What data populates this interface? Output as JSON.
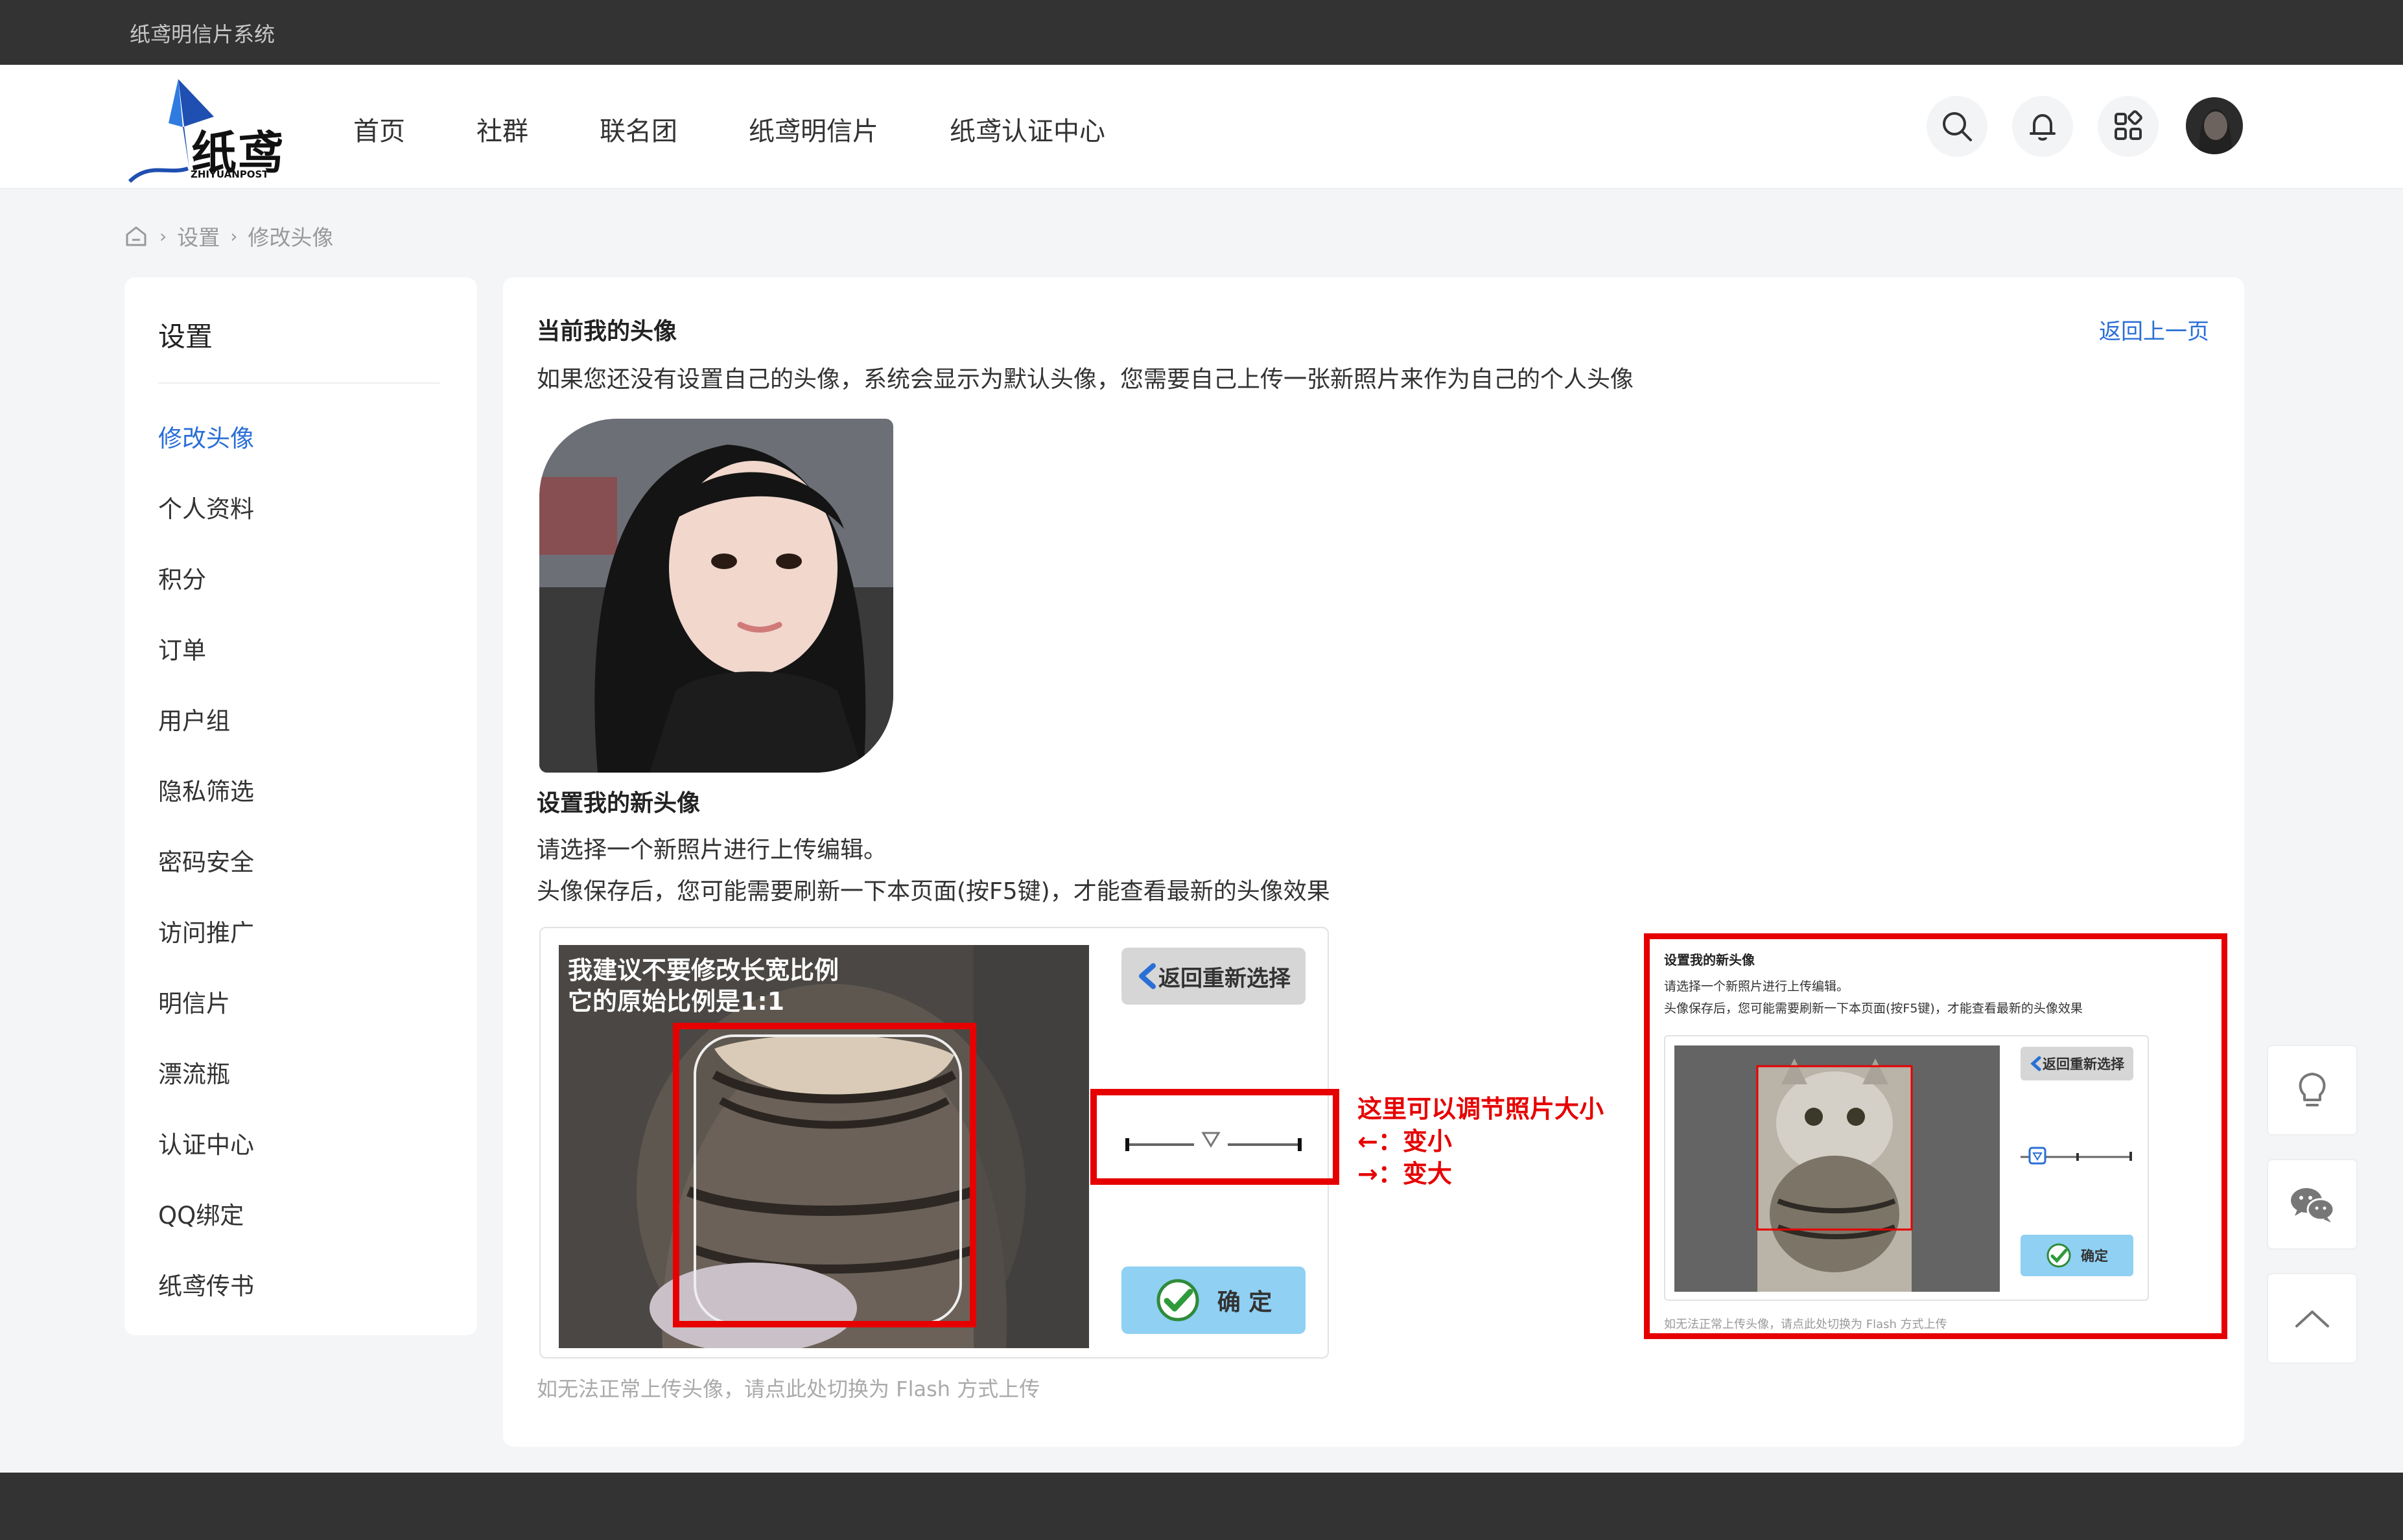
{
  "site": {
    "system_name": "纸鸢明信片系统"
  },
  "logo": {
    "text": "纸鸢",
    "sub": "ZHIYUANPOST"
  },
  "nav": [
    "首页",
    "社群",
    "联名团",
    "纸鸢明信片",
    "纸鸢认证中心"
  ],
  "header_icons": [
    "search-icon",
    "bell-icon",
    "apps-icon"
  ],
  "breadcrumb": {
    "home_icon": "home-icon",
    "items": [
      "设置",
      "修改头像"
    ],
    "separator": "›"
  },
  "sidebar": {
    "title": "设置",
    "items": [
      {
        "label": "修改头像",
        "active": true
      },
      {
        "label": "个人资料"
      },
      {
        "label": "积分"
      },
      {
        "label": "订单"
      },
      {
        "label": "用户组"
      },
      {
        "label": "隐私筛选"
      },
      {
        "label": "密码安全"
      },
      {
        "label": "访问推广"
      },
      {
        "label": "明信片"
      },
      {
        "label": "漂流瓶"
      },
      {
        "label": "认证中心"
      },
      {
        "label": "QQ绑定"
      },
      {
        "label": "纸鸢传书"
      }
    ]
  },
  "main": {
    "current_title": "当前我的头像",
    "back_link": "返回上一页",
    "current_desc": "如果您还没有设置自己的头像，系统会显示为默认头像，您需要自己上传一张新照片来作为自己的个人头像",
    "new_title": "设置我的新头像",
    "new_desc_1": "请选择一个新照片进行上传编辑。",
    "new_desc_2": "头像保存后，您可能需要刷新一下本页面(按F5键)，才能查看最新的头像效果",
    "photo_tip_1": "我建议不要修改长宽比例",
    "photo_tip_2": "它的原始比例是1:1",
    "reselect_button": "返回重新选择",
    "confirm_button": "确 定",
    "flash_note": "如无法正常上传头像，请点此处切换为 Flash 方式上传"
  },
  "annotation": {
    "line_1": "这里可以调节照片大小",
    "line_2": "←：变小",
    "line_3": "→：变大"
  },
  "preview": {
    "title": "设置我的新头像",
    "desc_1": "请选择一个新照片进行上传编辑。",
    "desc_2": "头像保存后，您可能需要刷新一下本页面(按F5键)，才能查看最新的头像效果",
    "reselect_button": "返回重新选择",
    "confirm_button": "确定",
    "note": "如无法正常上传头像，请点此处切换为 Flash 方式上传"
  },
  "float_icons": [
    "lightbulb-icon",
    "wechat-icon",
    "back-to-top-icon"
  ],
  "colors": {
    "accent": "#2a6fd6",
    "annotation": "#e60000",
    "topbar": "#333333",
    "confirm": "#8fd0f3"
  }
}
